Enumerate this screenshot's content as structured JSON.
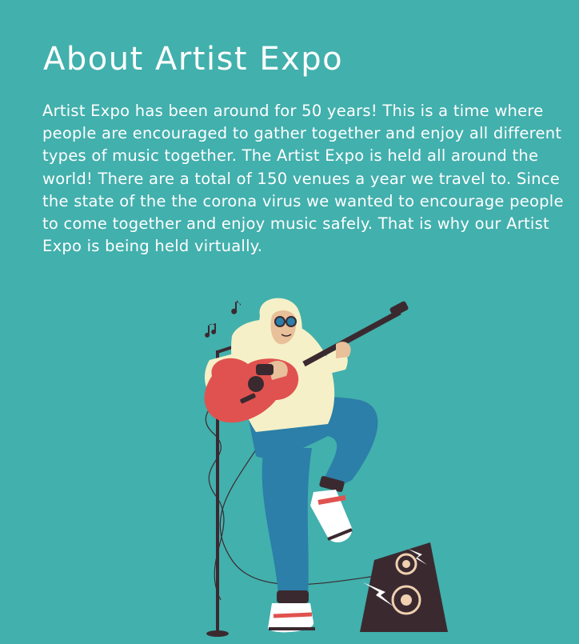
{
  "about": {
    "title": "About Artist Expo",
    "body": "Artist Expo has been around for 50 years! This is a time where people are encouraged to gather together and enjoy all different types of music together. The Artist Expo is held all around the world! There are a total of 150 venues a year we travel to. Since the state of the the corona virus we wanted to encourage people to come together and enjoy music safely. That is why our Artist Expo is being held virtually."
  },
  "colors": {
    "background": "#42b0ad",
    "text": "#ffffff",
    "hoodie": "#f5f0c8",
    "pants": "#2b7fa8",
    "guitar": "#e0524f",
    "speaker": "#3a2a30"
  }
}
